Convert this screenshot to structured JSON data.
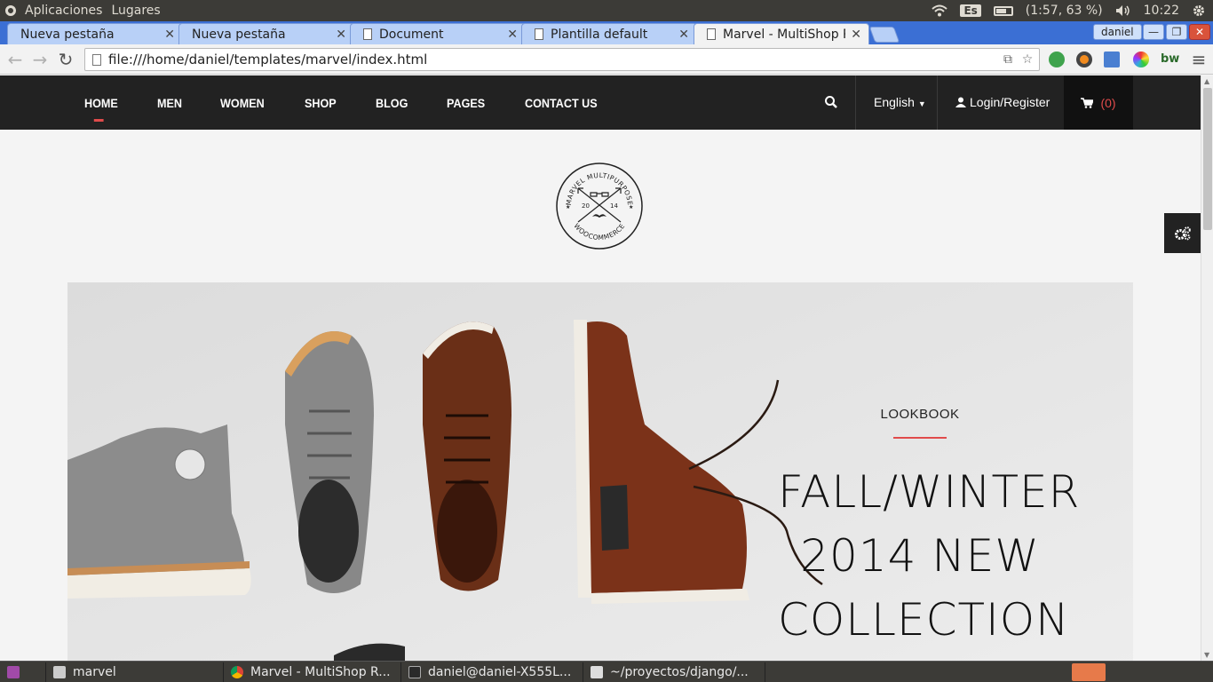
{
  "system_panel": {
    "menu_items": [
      "Aplicaciones",
      "Lugares"
    ],
    "keyboard_layout": "Es",
    "battery_text": "(1:57, 63 %)",
    "clock": "10:22"
  },
  "browser": {
    "tabs": [
      {
        "label": "Nueva pestaña",
        "active": false,
        "icon": false
      },
      {
        "label": "Nueva pestaña",
        "active": false,
        "icon": false
      },
      {
        "label": "Document",
        "active": false,
        "icon": true
      },
      {
        "label": "Plantilla default",
        "active": false,
        "icon": true
      },
      {
        "label": "Marvel - MultiShop R",
        "active": true,
        "icon": true
      }
    ],
    "profile_name": "daniel",
    "address": "file:///home/daniel/templates/marvel/index.html"
  },
  "site": {
    "nav_links": [
      "HOME",
      "MEN",
      "WOMEN",
      "SHOP",
      "BLOG",
      "PAGES",
      "CONTACT US"
    ],
    "language": "English",
    "login_label": "Login/Register",
    "cart_count": "(0)",
    "logo": {
      "top_text": "MARVEL MULTIPURPOSE",
      "bottom_text": "WOOCOMMERCE",
      "year_left": "20",
      "year_right": "14"
    },
    "hero": {
      "eyebrow": "LOOKBOOK",
      "headline_lines": [
        "FALL/WINTER",
        "2014 NEW",
        "COLLECTION"
      ]
    },
    "accent_color": "#e04b4b"
  },
  "taskbar": {
    "items": [
      "marvel",
      "Marvel - MultiShop R...",
      "daniel@daniel-X555L...",
      "~/proyectos/django/..."
    ]
  }
}
